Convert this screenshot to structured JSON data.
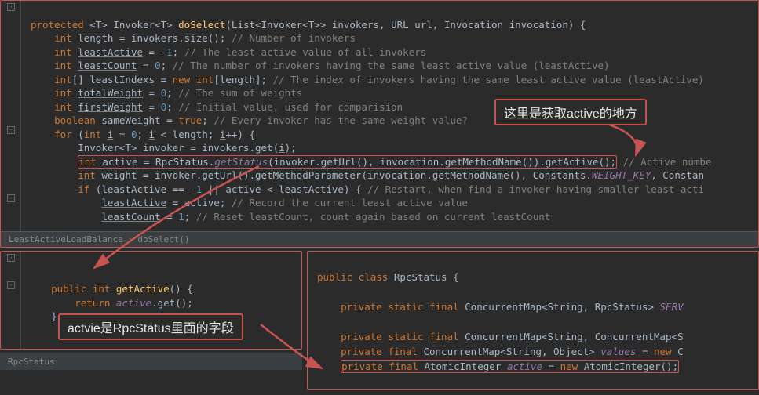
{
  "breadcrumb1": {
    "class": "LeastActiveLoadBalance",
    "method": "doSelect()"
  },
  "breadcrumb2": {
    "class": "RpcStatus"
  },
  "callout1": "这里是获取active的地方",
  "callout2": "actvie是RpcStatus里面的字段",
  "top": {
    "l1a": "protected ",
    "l1b": "<T> Invoker<T> ",
    "l1c": "doSelect",
    "l1d": "(List<Invoker<T>> invokers, URL url, Invocation invocation) {",
    "l2a": "int ",
    "l2b": "length = invokers.size(); ",
    "l2c": "// Number of invokers",
    "l3a": "int ",
    "l3b": "leastActive",
    "l3c": " = -",
    "l3d": "1",
    "l3e": "; ",
    "l3f": "// The least active value of all invokers",
    "l4a": "int ",
    "l4b": "leastCount",
    "l4c": " = ",
    "l4d": "0",
    "l4e": "; ",
    "l4f": "// The number of invokers having the same least active value (leastActive)",
    "l5a": "int",
    "l5b": "[] leastIndexs = ",
    "l5c": "new int",
    "l5d": "[length]; ",
    "l5e": "// The index of invokers having the same least active value (leastActive)",
    "l6a": "int ",
    "l6b": "totalWeight",
    "l6c": " = ",
    "l6d": "0",
    "l6e": "; ",
    "l6f": "// The sum of weights",
    "l7a": "int ",
    "l7b": "firstWeight",
    "l7c": " = ",
    "l7d": "0",
    "l7e": "; ",
    "l7f": "// Initial value, used for comparision",
    "l8a": "boolean ",
    "l8b": "sameWeight",
    "l8c": " = ",
    "l8d": "true",
    "l8e": "; ",
    "l8f": "// Every invoker has the same weight value?",
    "l9a": "for ",
    "l9b": "(",
    "l9c": "int ",
    "l9d": "i",
    "l9e": " = ",
    "l9f": "0",
    "l9g": "; ",
    "l9h": "i",
    "l9i": " < length; ",
    "l9j": "i",
    "l9k": "++) {",
    "l10": "Invoker<T> invoker = invokers.get(",
    "l10b": "i",
    "l10c": ");",
    "l11a": "int ",
    "l11b": "active = RpcStatus.",
    "l11c": "getStatus",
    "l11d": "(invoker.getUrl(), invocation.getMethodName()).getActive();",
    "l11e": " // Active numbe",
    "l12a": "int ",
    "l12b": "weight = invoker.getUrl().getMethodParameter(invocation.getMethodName(), Constants.",
    "l12c": "WEIGHT_KEY",
    "l12d": ", Constan",
    "l13a": "if ",
    "l13b": "(",
    "l13c": "leastActive",
    "l13d": " == -",
    "l13e": "1",
    "l13f": " || active < ",
    "l13g": "leastActive",
    "l13h": ") { ",
    "l13i": "// Restart, when find a invoker having smaller least acti",
    "l14a": "leastActive",
    "l14b": " = active; ",
    "l14c": "// Record the current least active value",
    "l15a": "leastCount",
    "l15b": " = ",
    "l15c": "1",
    "l15d": "; ",
    "l15e": "// Reset leastCount, count again based on current leastCount"
  },
  "left": {
    "l1a": "public int ",
    "l1b": "getActive",
    "l1c": "() {",
    "l2a": "return ",
    "l2b": "active",
    "l2c": ".get();",
    "l3": "}"
  },
  "right": {
    "l1a": "public class ",
    "l1b": "RpcStatus ",
    "l1c": "{",
    "l2a": "private static final ",
    "l2b": "ConcurrentMap<String, RpcStatus> ",
    "l2c": "SERV",
    "l3a": "private static final ",
    "l3b": "ConcurrentMap<String, ConcurrentMap<S",
    "l4a": "private final ",
    "l4b": "ConcurrentMap<String, Object> ",
    "l4c": "values ",
    "l4d": "= ",
    "l4e": "new ",
    "l4f": "C",
    "l5a": "private final ",
    "l5b": "AtomicInteger ",
    "l5c": "active ",
    "l5d": "= ",
    "l5e": "new ",
    "l5f": "AtomicInteger();"
  },
  "chart_data": null
}
